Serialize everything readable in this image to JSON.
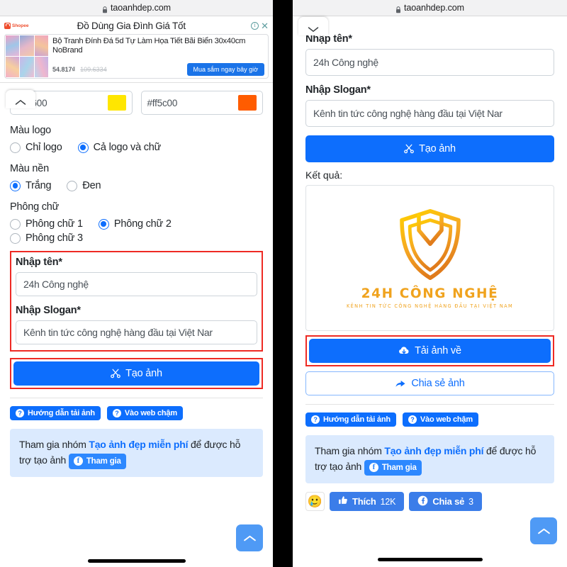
{
  "browser": {
    "url": "taoanhdep.com",
    "lock_icon": "lock-icon"
  },
  "ad": {
    "network_label": "Shopee",
    "headline": "Đồ Dùng Gia Đình Giá Tốt",
    "info_icon": "info-icon",
    "close_icon": "close-icon",
    "product_desc": "Bộ Tranh Đính Đá 5d Tự Làm Họa Tiết Bãi Biển 30x40cm NoBrand",
    "price": "54.817₫",
    "old_price": "109.6334",
    "cta": "Mua sắm ngay bây giờ"
  },
  "left_panel": {
    "collapse_icon": "chevron-up-icon",
    "color1": {
      "hex": "#ffe600",
      "swatch": "#ffe600"
    },
    "color2": {
      "hex": "#ff5c00",
      "swatch": "#ff5c00"
    },
    "logo_color": {
      "label": "Màu logo",
      "options": [
        {
          "label": "Chỉ logo",
          "selected": false
        },
        {
          "label": "Cả logo và chữ",
          "selected": true
        }
      ]
    },
    "bg_color": {
      "label": "Màu nền",
      "options": [
        {
          "label": "Trắng",
          "selected": true
        },
        {
          "label": "Đen",
          "selected": false
        }
      ]
    },
    "font": {
      "label": "Phông chữ",
      "options": [
        {
          "label": "Phông chữ 1",
          "selected": false
        },
        {
          "label": "Phông chữ 2",
          "selected": true
        },
        {
          "label": "Phông chữ 3",
          "selected": false
        }
      ]
    },
    "name_field": {
      "label": "Nhập tên*",
      "value": "24h Công nghệ"
    },
    "slogan_field": {
      "label": "Nhập Slogan*",
      "value": "Kênh tin tức công nghệ hàng đầu tại Việt Nar"
    },
    "create_button": {
      "label": "Tạo ảnh",
      "icon": "scissors-icon"
    },
    "pills": [
      {
        "label": "Hướng dẫn tải ảnh",
        "icon": "question-icon"
      },
      {
        "label": "Vào web chậm",
        "icon": "question-icon"
      }
    ],
    "notice": {
      "prefix": "Tham gia nhóm ",
      "link": "Tạo ảnh đẹp miễn phí",
      "middle": " để được hỗ trợ tạo ảnh ",
      "chip": "Tham gia",
      "chip_icon": "facebook-icon"
    },
    "fab_icon": "chevron-up-icon"
  },
  "right_panel": {
    "collapse_icon": "chevron-down-icon",
    "name_field": {
      "label": "Nhập tên*",
      "value": "24h Công nghệ"
    },
    "slogan_field": {
      "label": "Nhập Slogan*",
      "value": "Kênh tin tức công nghệ hàng đầu tại Việt Nar"
    },
    "create_button": {
      "label": "Tạo ảnh",
      "icon": "scissors-icon"
    },
    "result_label": "Kết quả:",
    "result_logo": {
      "icon": "shield-logo-icon",
      "name": "24H CÔNG NGHỆ",
      "tagline": "KÊNH TIN TỨC CÔNG NGHỆ HÀNG ĐẦU TẠI VIỆT NAM",
      "color_start": "#ffd400",
      "color_end": "#e8821e"
    },
    "download_button": {
      "label": "Tải ảnh về",
      "icon": "cloud-download-icon"
    },
    "share_button": {
      "label": "Chia sẻ ảnh",
      "icon": "share-icon"
    },
    "pills": [
      {
        "label": "Hướng dẫn tải ảnh",
        "icon": "question-icon"
      },
      {
        "label": "Vào web chậm",
        "icon": "question-icon"
      }
    ],
    "notice": {
      "prefix": "Tham gia nhóm ",
      "link": "Tạo ảnh đẹp miễn phí",
      "middle": " để được hỗ trợ tạo ảnh ",
      "chip": "Tham gia",
      "chip_icon": "facebook-icon"
    },
    "social": {
      "emoji": "🥲",
      "like": {
        "label": "Thích",
        "count": "12K",
        "icon": "thumbs-up-icon"
      },
      "share": {
        "label": "Chia sẻ",
        "count": "3",
        "icon": "facebook-icon"
      }
    },
    "fab_icon": "chevron-up-icon"
  },
  "colors": {
    "primary": "#0d6efd",
    "highlight": "#ee2a24",
    "notice_bg": "#dbeafe"
  }
}
